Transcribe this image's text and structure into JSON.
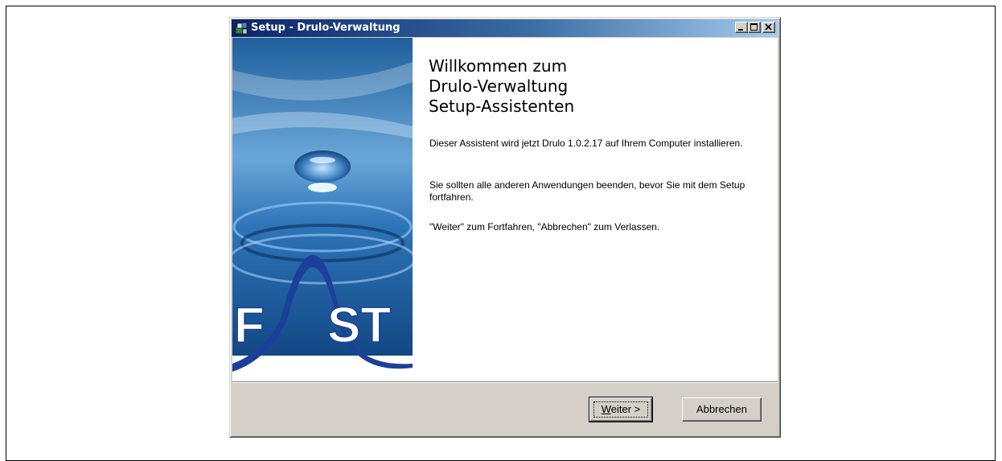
{
  "window": {
    "title": "Setup - Drulo-Verwaltung"
  },
  "sidebar_image": {
    "logo_text": "FAST",
    "description": "water droplet"
  },
  "welcome": {
    "title_line1": "Willkommen zum",
    "title_line2": "Drulo-Verwaltung",
    "title_line3": "Setup-Assistenten",
    "paragraph1": "Dieser Assistent wird jetzt Drulo 1.0.2.17 auf Ihrem Computer installieren.",
    "paragraph2": "Sie sollten alle anderen Anwendungen beenden, bevor Sie mit dem Setup fortfahren.",
    "paragraph3": "\"Weiter\" zum Fortfahren, \"Abbrechen\" zum Verlassen."
  },
  "buttons": {
    "next_accel": "W",
    "next_rest": "eiter >",
    "cancel": "Abbrechen"
  },
  "colors": {
    "titlebar_start": "#0a246a",
    "titlebar_end": "#a6caf0",
    "face": "#d4d0c8"
  }
}
